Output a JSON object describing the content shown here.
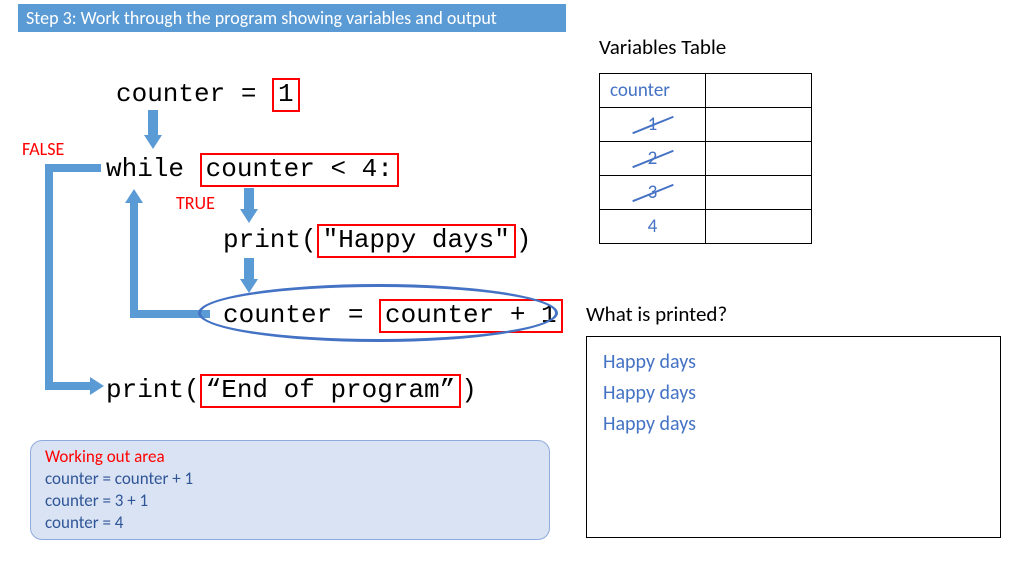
{
  "header": "Step 3: Work through the program showing variables and output",
  "code": {
    "l1a": "counter = ",
    "l1b": "1",
    "l2a": "while ",
    "l2b": "counter < 4:",
    "l3a": "print(",
    "l3b": "\"Happy days\"",
    "l3c": ")",
    "l4a": "counter = ",
    "l4b": "counter + 1",
    "l5a": "print(",
    "l5b": "“End of program”",
    "l5c": ")"
  },
  "labels": {
    "false": "FALSE",
    "true": "TRUE"
  },
  "vt": {
    "title": "Variables Table",
    "header": "counter",
    "rows": [
      "1",
      "2",
      "3",
      "4"
    ],
    "struck": [
      true,
      true,
      true,
      false
    ]
  },
  "printed": {
    "title": "What is printed?",
    "lines": [
      "Happy days",
      "Happy days",
      "Happy days"
    ]
  },
  "working": {
    "title": "Working out area",
    "lines": [
      "counter = counter + 1",
      "counter = 3 + 1",
      "counter = 4"
    ]
  },
  "chart_data": {
    "type": "flow-trace",
    "program": [
      "counter = 1",
      "while counter < 4:",
      "    print(\"Happy days\")",
      "    counter = counter + 1",
      "print(\"End of program\")"
    ],
    "variable_history": {
      "counter": [
        1,
        2,
        3,
        4
      ]
    },
    "output": [
      "Happy days",
      "Happy days",
      "Happy days"
    ],
    "annotations": {
      "loop_true_branch": "TRUE",
      "loop_false_branch": "FALSE"
    }
  }
}
